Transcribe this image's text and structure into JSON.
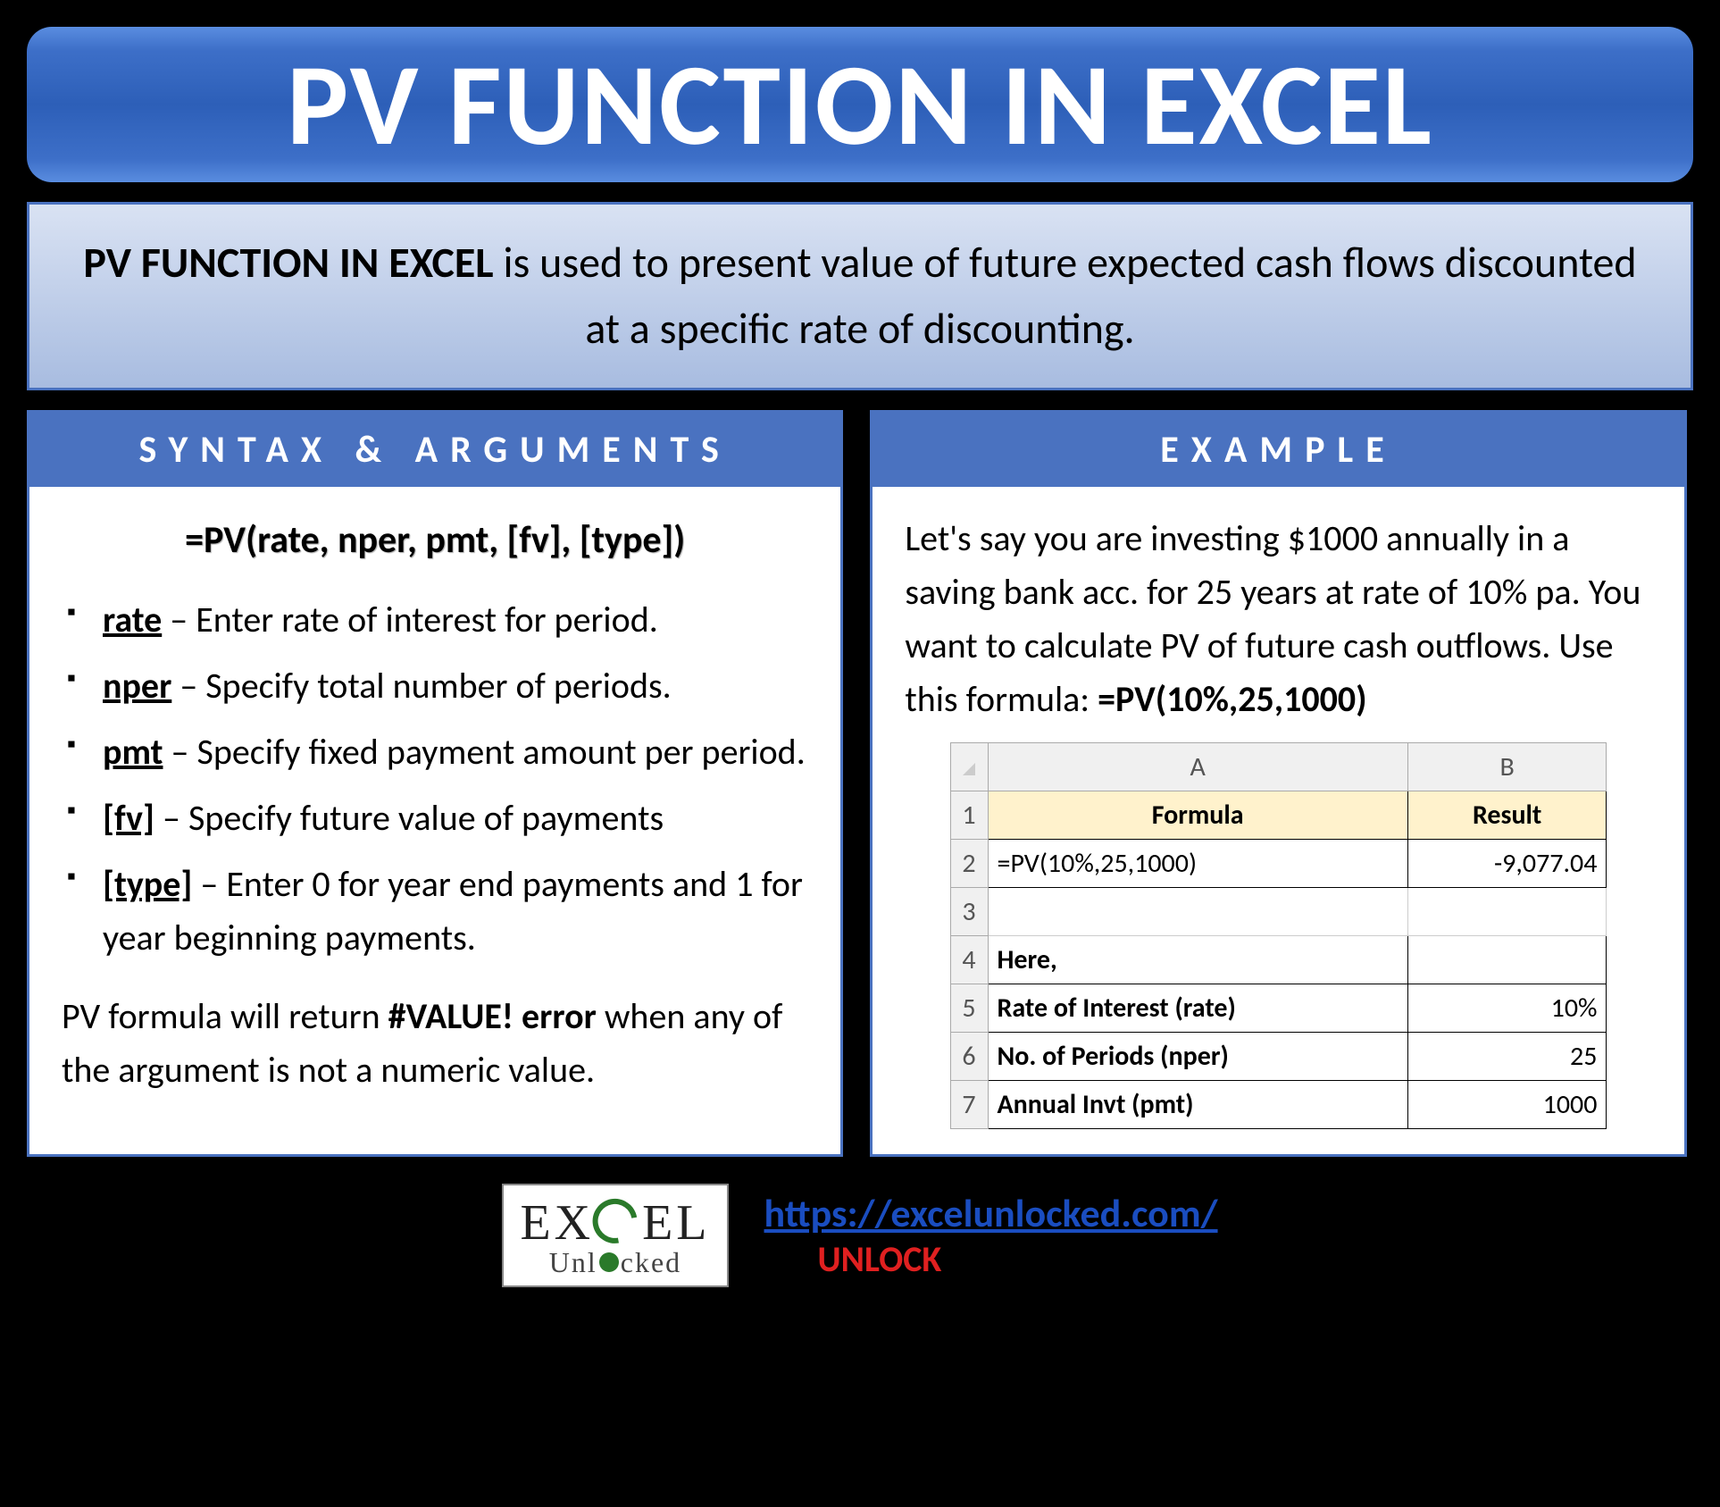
{
  "title": "PV FUNCTION IN EXCEL",
  "description": {
    "bold": "PV FUNCTION IN EXCEL",
    "rest": " is used to present value of future expected cash flows discounted at a specific rate of discounting."
  },
  "left": {
    "header": "SYNTAX & ARGUMENTS",
    "formula": "=PV(rate, nper, pmt, [fv], [type])",
    "args": [
      {
        "name": "rate",
        "desc": " – Enter rate of interest for period."
      },
      {
        "name": "nper",
        "desc": " – Specify total number of periods."
      },
      {
        "name": "pmt",
        "desc": " – Specify fixed payment amount per period."
      },
      {
        "name": "[fv]",
        "desc": " – Specify future value of payments"
      },
      {
        "name": "[type]",
        "desc": " – Enter 0 for year end payments and 1 for year beginning payments."
      }
    ],
    "note_pre": "PV formula will return ",
    "note_bold": "#VALUE! error",
    "note_post": " when any of the argument is not a numeric value."
  },
  "right": {
    "header": "EXAMPLE",
    "text_pre": "Let's say you are investing $1000 annually in a saving bank acc. for 25 years at rate of 10% pa. You want to calculate PV of future cash outflows. Use this formula: ",
    "text_bold": "=PV(10%,25,1000)",
    "grid": {
      "colA": "A",
      "colB": "B",
      "rows": [
        {
          "n": "1",
          "a": "Formula",
          "b": "Result",
          "hdr": true
        },
        {
          "n": "2",
          "a": "=PV(10%,25,1000)",
          "b": "-9,077.04"
        },
        {
          "n": "3",
          "a": "",
          "b": "",
          "empty": true
        },
        {
          "n": "4",
          "a": "Here,",
          "b": "",
          "bold": true
        },
        {
          "n": "5",
          "a": "Rate of Interest (rate)",
          "b": "10%",
          "bold": true
        },
        {
          "n": "6",
          "a": "No. of Periods (nper)",
          "b": "25",
          "bold": true
        },
        {
          "n": "7",
          "a": "Annual Invt (pmt)",
          "b": "1000",
          "bold": true
        }
      ]
    }
  },
  "footer": {
    "logo_top_pre": "EX",
    "logo_top_post": "EL",
    "logo_bottom_pre": "Unl",
    "logo_bottom_post": "cked",
    "url": "https://excelunlocked.com/",
    "unlock": "UNLOCK"
  }
}
